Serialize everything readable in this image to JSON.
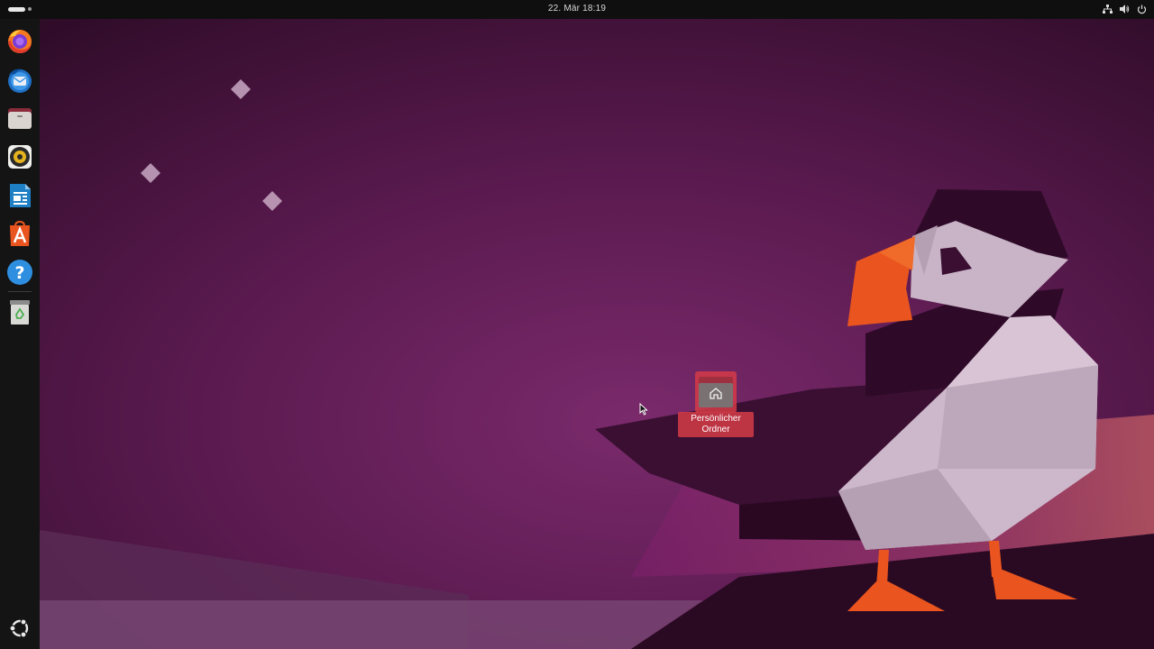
{
  "topbar": {
    "clock": "22. Mär  18:19",
    "tray_icons": [
      "network-icon",
      "volume-icon",
      "power-icon"
    ]
  },
  "dock": {
    "apps": [
      {
        "name": "Firefox",
        "icon": "firefox-icon"
      },
      {
        "name": "Thunderbird",
        "icon": "thunderbird-icon"
      },
      {
        "name": "Dateien",
        "icon": "files-icon"
      },
      {
        "name": "Rhythmbox",
        "icon": "rhythmbox-icon"
      },
      {
        "name": "LibreOffice Writer",
        "icon": "writer-icon"
      },
      {
        "name": "Ubuntu Software",
        "icon": "software-center-icon"
      },
      {
        "name": "Hilfe",
        "icon": "help-icon"
      },
      {
        "name": "Papierkorb",
        "icon": "trash-icon"
      }
    ],
    "show_apps_icon": "ubuntu-logo-icon"
  },
  "desktop": {
    "home_folder_label": "Persönlicher Ordner",
    "home_folder_line1": "Persönlicher",
    "home_folder_line2": "Ordner"
  },
  "colors": {
    "selection": "#d53b46",
    "wallpaper_dark": "#2a0a22",
    "wallpaper_mid": "#6a1f5c",
    "puffin_beak": "#e9541f",
    "panel": "#0f0f0f"
  }
}
